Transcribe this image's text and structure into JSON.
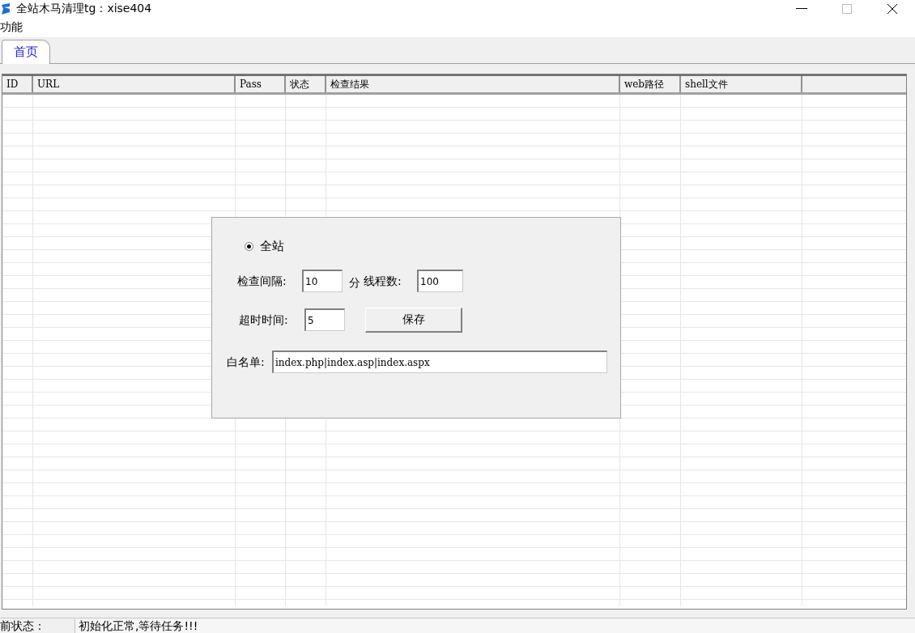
{
  "window": {
    "title": "全站木马清理tg：xise404"
  },
  "menu": [
    "功能"
  ],
  "tabs": [
    {
      "label": "首页",
      "selected": true
    }
  ],
  "table": {
    "columns": [
      "ID",
      "URL",
      "Pass",
      "状态",
      "检查结果",
      "web路径",
      "shell文件"
    ]
  },
  "settings": {
    "scope": {
      "label": "全站",
      "selected": true
    },
    "interval": {
      "label": "检查间隔:",
      "value": "10",
      "unit": "分"
    },
    "threads": {
      "label": "线程数:",
      "value": "100"
    },
    "timeout": {
      "label": "超时时间:",
      "value": "5"
    },
    "save_button": "保存",
    "whitelist": {
      "label": "白名单:",
      "value": "index.php|index.asp|index.aspx"
    }
  },
  "status_bar": {
    "label": "前状态：",
    "message": "初始化正常,等待任务!!!"
  }
}
